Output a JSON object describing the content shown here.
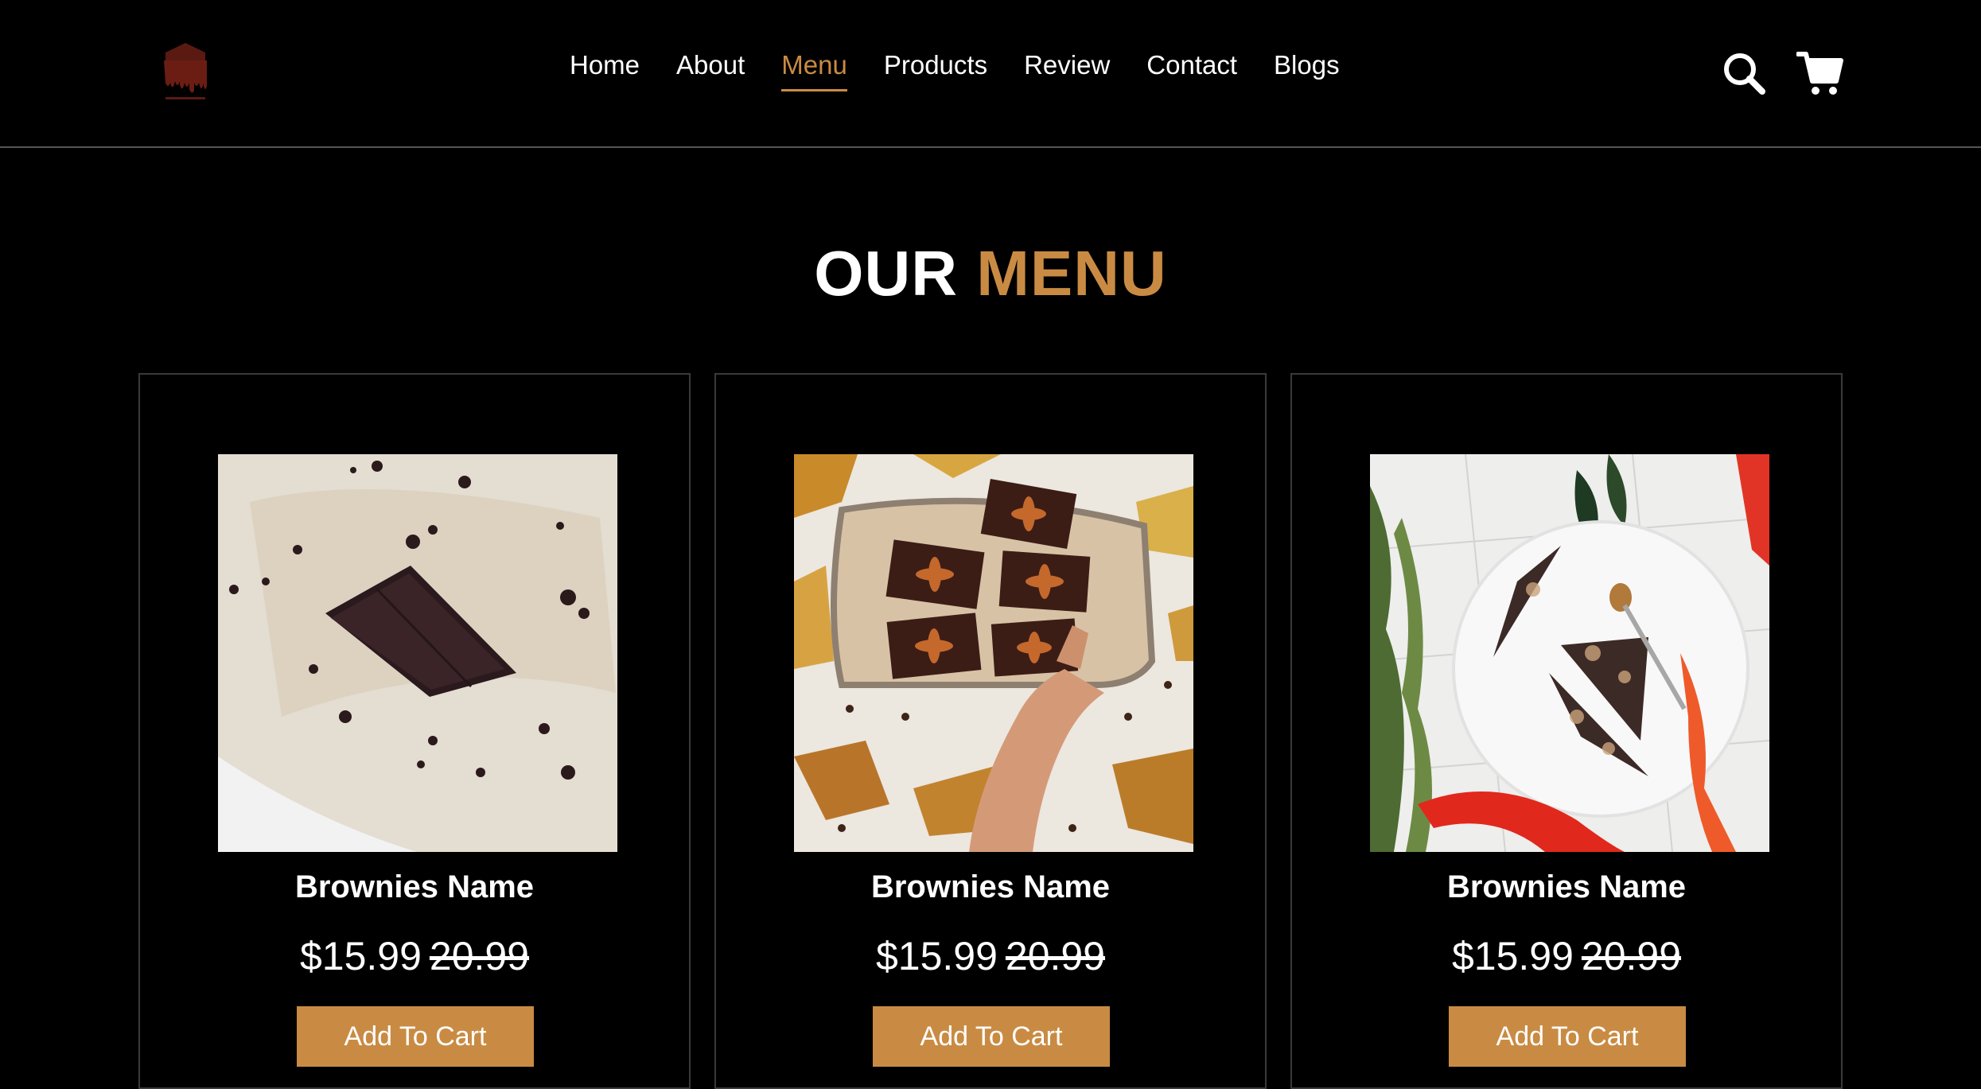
{
  "header": {
    "logo_icon": "brownie-logo-icon",
    "nav": [
      {
        "label": "Home",
        "active": false
      },
      {
        "label": "About",
        "active": false
      },
      {
        "label": "Menu",
        "active": true
      },
      {
        "label": "Products",
        "active": false
      },
      {
        "label": "Review",
        "active": false
      },
      {
        "label": "Contact",
        "active": false
      },
      {
        "label": "Blogs",
        "active": false
      }
    ],
    "search_icon": "search-icon",
    "cart_icon": "cart-icon"
  },
  "section": {
    "title_part1": "OUR",
    "title_part2": "MENU"
  },
  "products": [
    {
      "name": "Brownies Name",
      "price": "$15.99",
      "old_price": "20.99",
      "button": "Add To Cart"
    },
    {
      "name": "Brownies Name",
      "price": "$15.99",
      "old_price": "20.99",
      "button": "Add To Cart"
    },
    {
      "name": "Brownies Name",
      "price": "$15.99",
      "old_price": "20.99",
      "button": "Add To Cart"
    }
  ],
  "colors": {
    "background": "#000000",
    "accent": "#c98b43",
    "text": "#ffffff",
    "border": "#3a3a3a"
  }
}
